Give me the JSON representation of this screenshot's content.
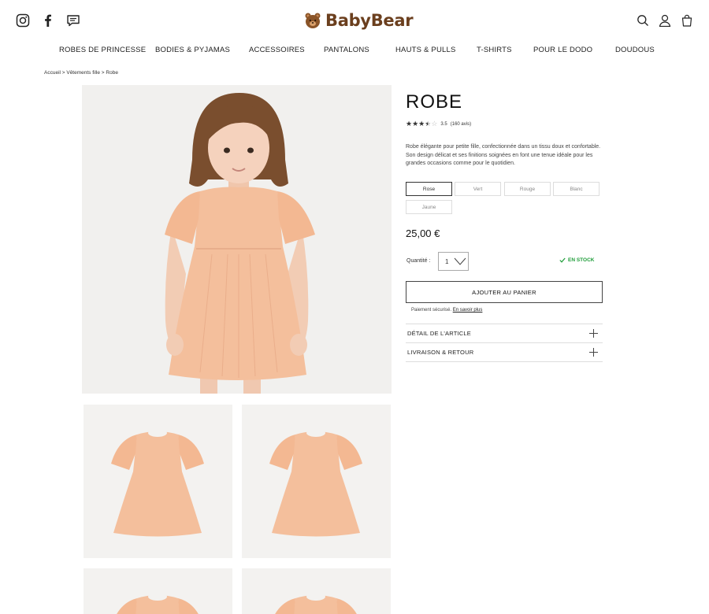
{
  "brand": {
    "name": "BabyBear",
    "color": "#6b3f1e"
  },
  "header": {
    "social_icons": [
      "instagram-icon",
      "facebook-icon",
      "chat-icon"
    ],
    "utility_icons": [
      "search-icon",
      "account-icon",
      "bag-icon"
    ]
  },
  "nav": {
    "items": [
      {
        "label": "ROBES DE PRINCESSE"
      },
      {
        "label": "BODIES & PYJAMAS"
      },
      {
        "label": "ACCESSOIRES"
      },
      {
        "label": "PANTALONS"
      },
      {
        "label": "HAUTS & PULLS"
      },
      {
        "label": "T-SHIRTS"
      },
      {
        "label": "POUR LE DODO"
      },
      {
        "label": "DOUDOUS"
      }
    ]
  },
  "breadcrumb": {
    "text": "Accueil > Vêtements fille > Robe"
  },
  "product": {
    "title": "ROBE",
    "rating": {
      "value": 3.5,
      "max": 5,
      "score_text": "3.5",
      "reviews_text": "(160 avis)"
    },
    "description": "Robe élégante pour petite fille, confectionnée dans un tissu doux et confortable. Son design délicat et ses finitions soignées en font une tenue idéale pour les grandes occasions comme pour le quotidien.",
    "colors": [
      {
        "label": "Rose",
        "selected": true
      },
      {
        "label": "Vert",
        "selected": false
      },
      {
        "label": "Rouge",
        "selected": false
      },
      {
        "label": "Blanc",
        "selected": false
      },
      {
        "label": "Jaune",
        "selected": false
      }
    ],
    "price": "25,00 €",
    "quantity": {
      "label": "Quantité :",
      "value": "1"
    },
    "stock": {
      "text": "EN STOCK",
      "color": "#1f9d3a"
    },
    "add_to_cart": "AJOUTER AU PANIER",
    "secure_payment": {
      "text": "Paiement sécurisé.",
      "link": "En savoir plus"
    },
    "accordion": [
      {
        "label": "DÉTAIL DE L'ARTICLE"
      },
      {
        "label": "LIVRAISON & RETOUR"
      }
    ],
    "dress_color": "#f4bf9c"
  }
}
